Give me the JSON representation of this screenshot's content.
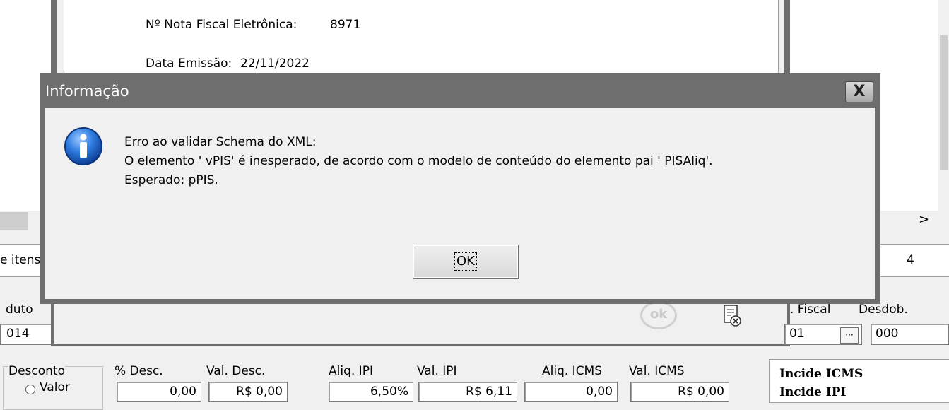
{
  "background": {
    "nfe_label": "Nº Nota Fiscal Eletrônica:",
    "nfe_value": "8971",
    "emission_label": "Data Emissão:",
    "emission_value": "22/11/2022",
    "itens_label": "e itens",
    "itens_count": "4",
    "produto_label": "duto",
    "produto_value": "014",
    "fiscal_label": ". Fiscal",
    "fiscal_value": "01",
    "ellipsis": "···",
    "desdob_label": "Desdob.",
    "desdob_value": "000",
    "desconto_label": "Desconto",
    "valor_radio_label": "Valor",
    "pct_desc_label": "% Desc.",
    "pct_desc_value": "0,00",
    "val_desc_label": "Val. Desc.",
    "val_desc_value": "R$ 0,00",
    "aliq_ipi_label": "Aliq. IPI",
    "aliq_ipi_value": "6,50%",
    "val_ipi_label": "Val. IPI",
    "val_ipi_value": "R$ 6,11",
    "aliq_icms_label": "Aliq. ICMS",
    "aliq_icms_value": "0,00",
    "val_icms_label": "Val. ICMS",
    "val_icms_value": "R$ 0,00",
    "incide_icms": "Incide ICMS",
    "incide_ipi": "Incide IPI",
    "ok_icon_text": "ok",
    "scroll_arrow": ">"
  },
  "dialog": {
    "title": "Informação",
    "close_label": "X",
    "message_line1": "Erro ao validar Schema do XML:",
    "message_line2": "O elemento ' vPIS' é inesperado, de acordo com o modelo de conteúdo do elemento pai ' PISAliq'.",
    "message_line3": "Esperado:  pPIS.",
    "ok_label": "OK",
    "icon": "information-icon",
    "icon_color": "#1a5fbf"
  }
}
